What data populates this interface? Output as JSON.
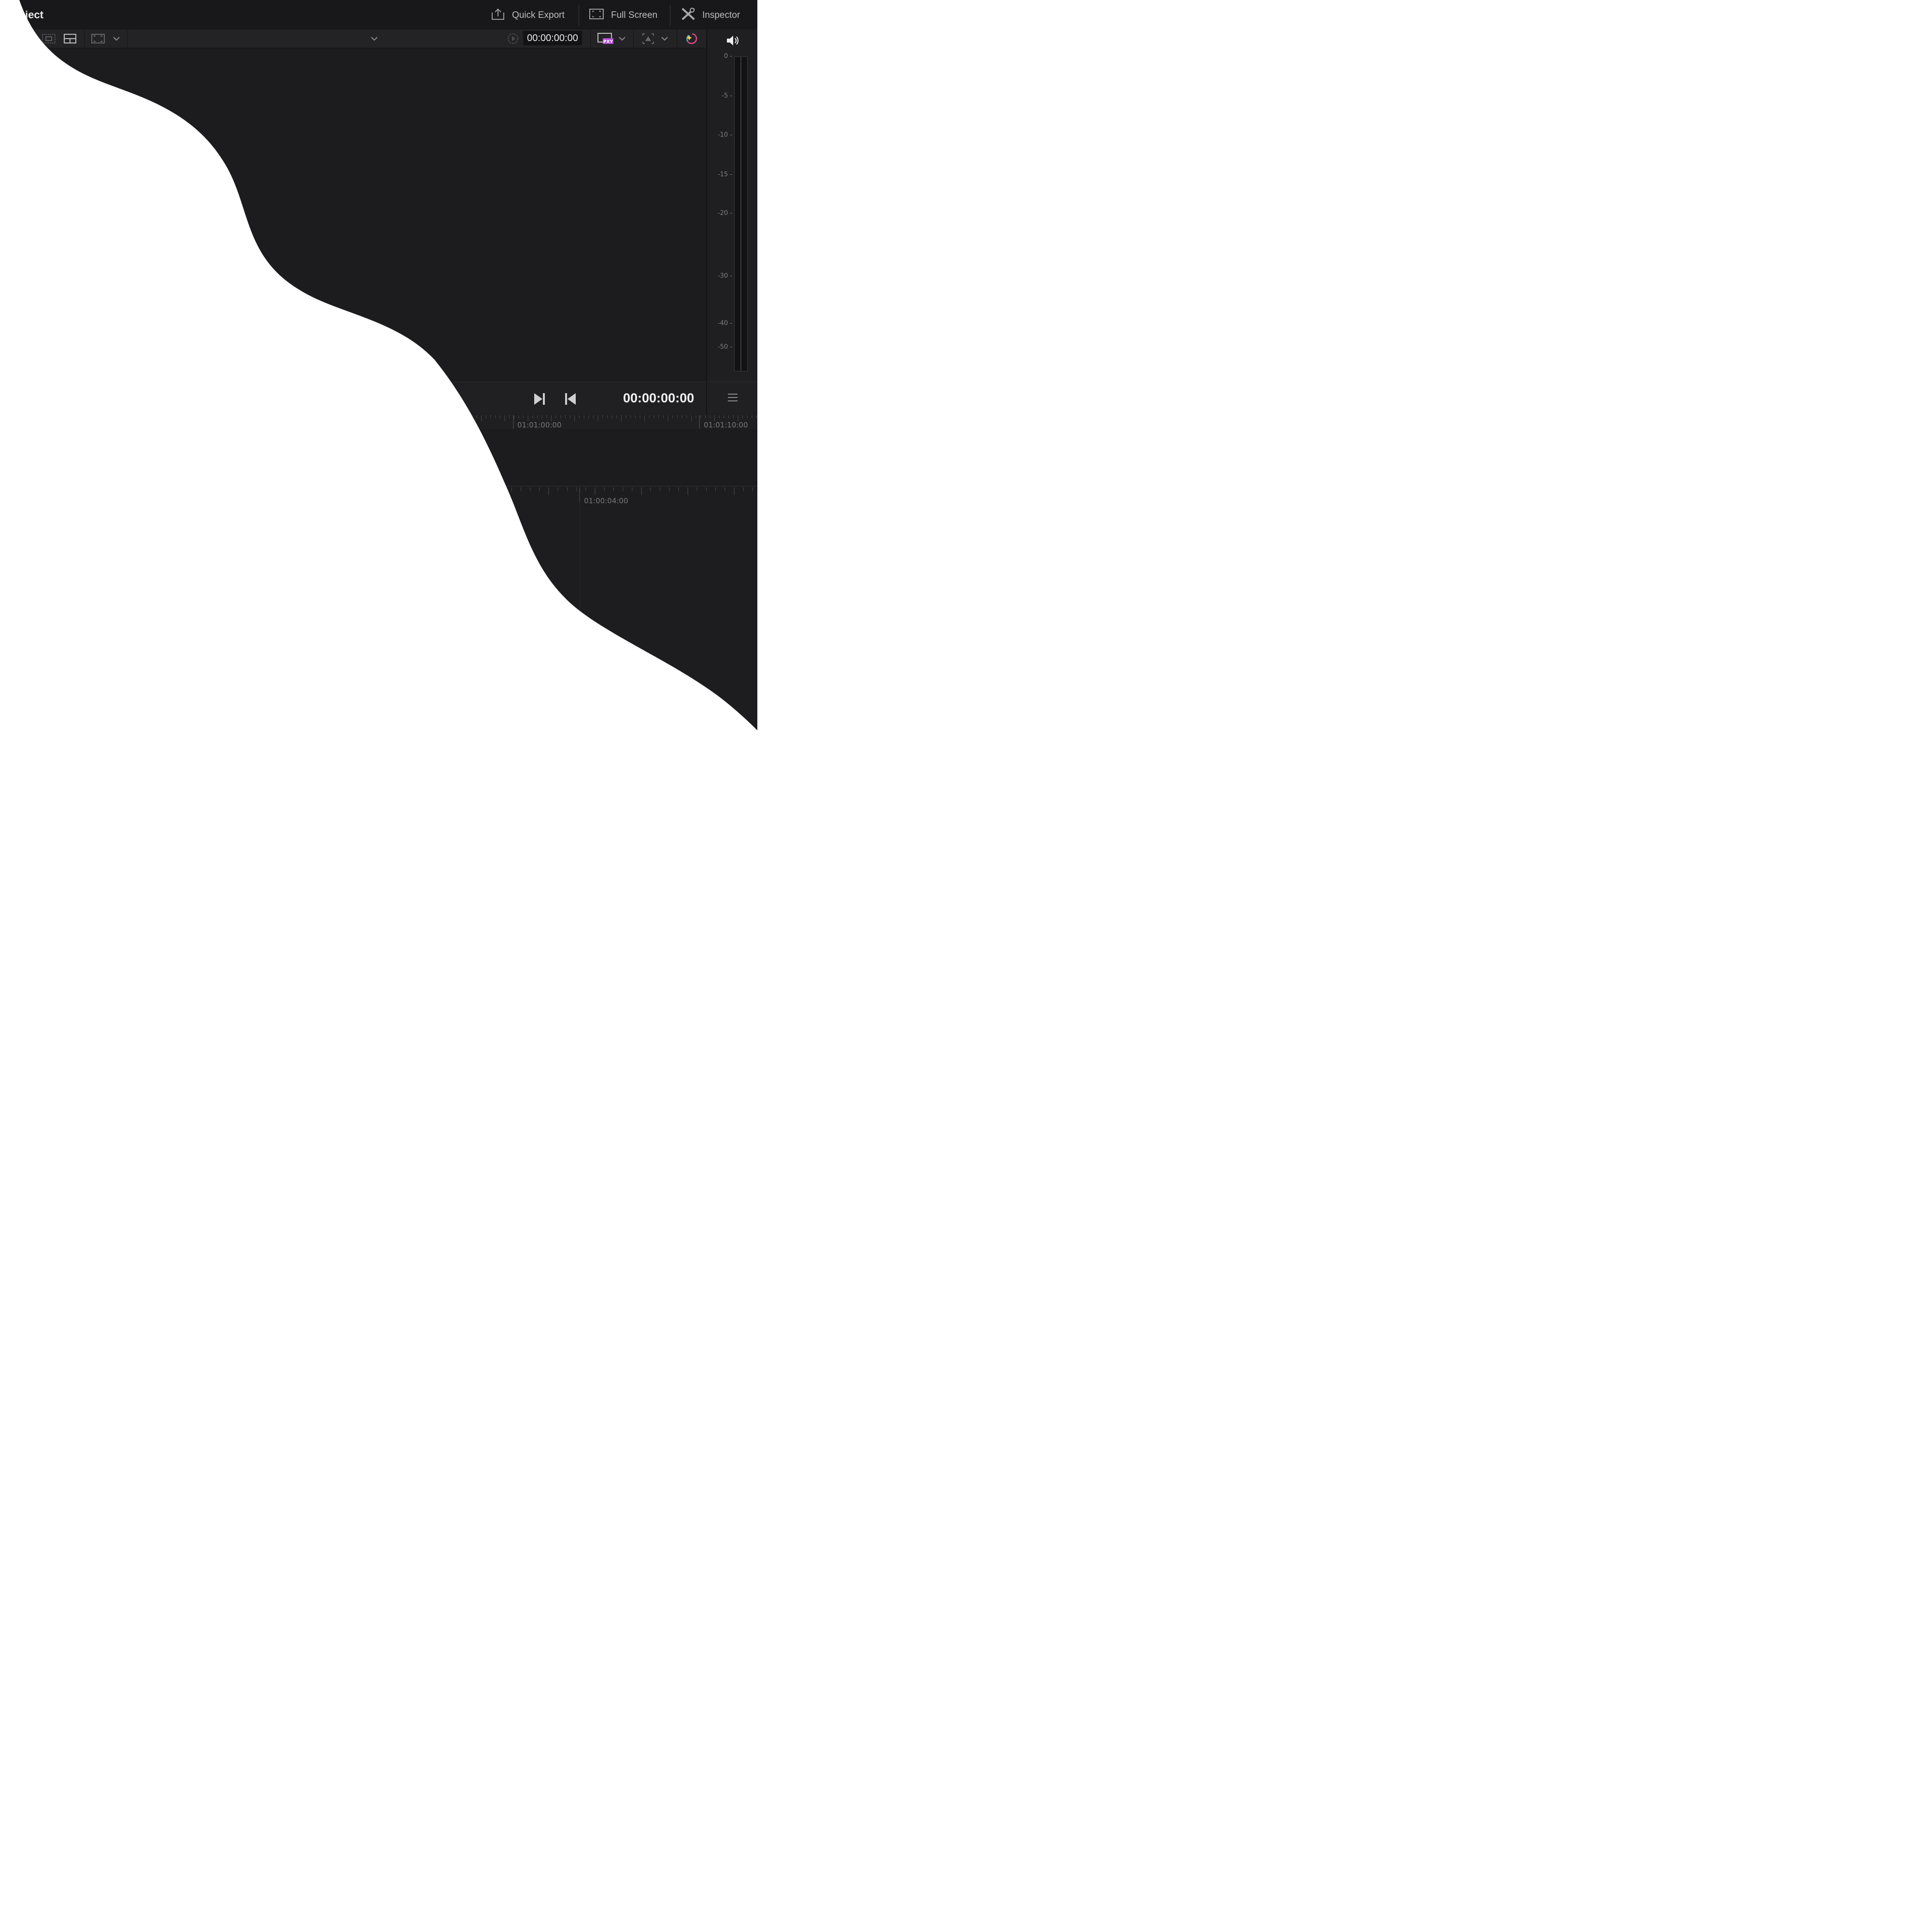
{
  "project": {
    "title": "roject"
  },
  "top_actions": [
    {
      "label": "Quick Export",
      "icon": "export-icon"
    },
    {
      "label": "Full Screen",
      "icon": "fullscreen-icon"
    },
    {
      "label": "Inspector",
      "icon": "inspector-icon"
    }
  ],
  "viewer": {
    "timecode": "00:00:00:00",
    "proxy_badge": "PXY",
    "playback_timecode": "00:00:00:00"
  },
  "audio_meter": {
    "scale": [
      "0 -",
      "-5 -",
      "-10 -",
      "-15 -",
      "-20 -",
      "-30 -",
      "-40 -",
      "-50 -"
    ]
  },
  "timeline_upper": {
    "ticks": [
      "01:01:00:00",
      "01:01:10:00"
    ]
  },
  "timeline_lower": {
    "ticks": [
      "01:00:04:00"
    ]
  },
  "colors": {
    "background": "#1e1e20",
    "topbar": "#18181a",
    "text_primary": "#f2f2f2",
    "text_secondary": "#bdbdbd",
    "proxy_badge": "#b24bd6"
  }
}
